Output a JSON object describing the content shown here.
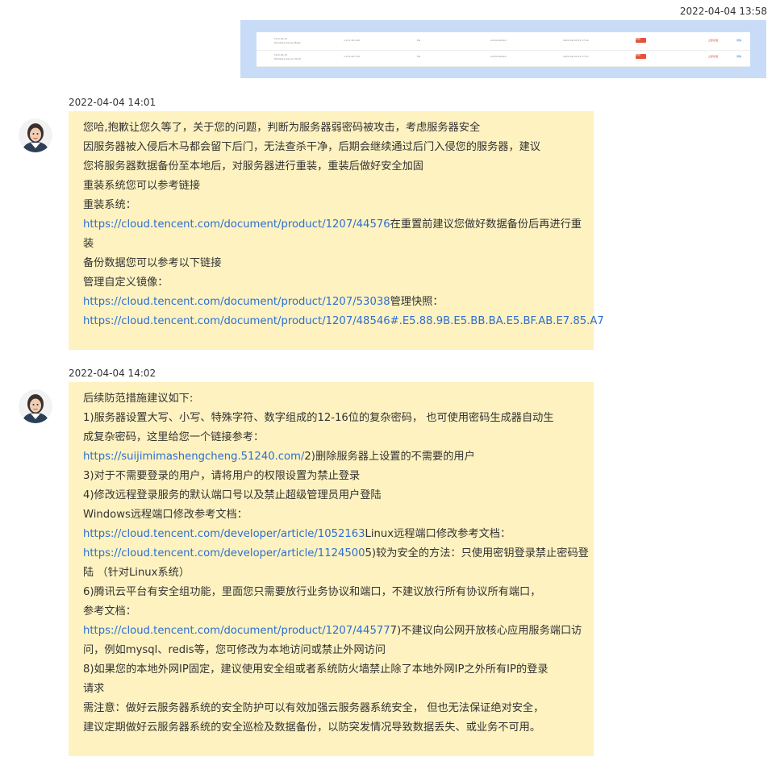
{
  "sent": {
    "timestamp": "2022-04-04 13:58",
    "screenshot_rows": [
      {
        "name": "10.0.16.15",
        "sub": "Windows Server Basic",
        "ip": "1.117.20.144",
        "type": "Pw",
        "user": "administrator",
        "time": "2022-04-03 22:17:42",
        "badge": "危险",
        "op": "立即处理",
        "link": "详情"
      },
      {
        "name": "10.0.16.15",
        "sub": "Windows Server 2019",
        "ip": "1.115.20.176",
        "type": "Pw",
        "user": "administrator",
        "time": "2022-04-03 22:17:47",
        "badge": "危险",
        "op": "立即处理",
        "link": "详情"
      }
    ]
  },
  "messages": [
    {
      "timestamp": "2022-04-04 14:01",
      "lines": [
        [
          {
            "t": "您哈,抱歉让您久等了，关于您的问题，判断为服务器弱密码被攻击，考虑服务器安全"
          }
        ],
        [
          {
            "t": "因服务器被入侵后木马都会留下后门，无法查杀干净，后期会继续通过后门入侵您的服务器，建议"
          }
        ],
        [
          {
            "t": "您将服务器数据备份至本地后，对服务器进行重装，重装后做好安全加固"
          }
        ],
        [
          {
            "t": "重装系统您可以参考链接"
          }
        ],
        [
          {
            "t": "重装系统："
          }
        ],
        [
          {
            "t": "https://cloud.tencent.com/document/product/1207/44576",
            "link": true
          },
          {
            "t": "在重置前建议您做好数据备份后再进行重"
          }
        ],
        [
          {
            "t": "装"
          }
        ],
        [
          {
            "t": "备份数据您可以参考以下链接"
          }
        ],
        [
          {
            "t": "管理自定义镜像："
          }
        ],
        [
          {
            "t": "https://cloud.tencent.com/document/product/1207/53038",
            "link": true
          },
          {
            "t": "管理快照："
          }
        ],
        [
          {
            "t": "https://cloud.tencent.com/document/product/1207/48546#.E5.88.9B.E5.BB.BA.E5.BF.AB.E7.85.A7",
            "link": true
          }
        ]
      ]
    },
    {
      "timestamp": "2022-04-04 14:02",
      "lines": [
        [
          {
            "t": "后续防范措施建议如下:"
          }
        ],
        [
          {
            "t": "1)服务器设置大写、小写、特殊字符、数字组成的12-16位的复杂密码， 也可使用密码生成器自动生"
          }
        ],
        [
          {
            "t": "成复杂密码，这里给您一个链接参考："
          }
        ],
        [
          {
            "t": "https://suijimimashengcheng.51240.com/",
            "link": true
          },
          {
            "t": "2)删除服务器上设置的不需要的用户"
          }
        ],
        [
          {
            "t": "3)对于不需要登录的用户，请将用户的权限设置为禁止登录"
          }
        ],
        [
          {
            "t": "4)修改远程登录服务的默认端口号以及禁止超级管理员用户登陆"
          }
        ],
        [
          {
            "t": "Windows远程端口修改参考文档："
          }
        ],
        [
          {
            "t": "https://cloud.tencent.com/developer/article/1052163",
            "link": true
          },
          {
            "t": "Linux远程端口修改参考文档："
          }
        ],
        [
          {
            "t": "https://cloud.tencent.com/developer/article/1124500",
            "link": true
          },
          {
            "t": "5)较为安全的方法：只使用密钥登录禁止密码登"
          }
        ],
        [
          {
            "t": "陆 （针对Linux系统）"
          }
        ],
        [
          {
            "t": "6)腾讯云平台有安全组功能，里面您只需要放行业务协议和端口，不建议放行所有协议所有端口，"
          }
        ],
        [
          {
            "t": "参考文档："
          }
        ],
        [
          {
            "t": "https://cloud.tencent.com/document/product/1207/44577",
            "link": true
          },
          {
            "t": "7)不建议向公网开放核心应用服务端口访"
          }
        ],
        [
          {
            "t": "问，例如mysql、redis等，您可修改为本地访问或禁止外网访问"
          }
        ],
        [
          {
            "t": "8)如果您的本地外网IP固定，建议使用安全组或者系统防火墙禁止除了本地外网IP之外所有IP的登录"
          }
        ],
        [
          {
            "t": "请求"
          }
        ],
        [
          {
            "t": "需注意：做好云服务器系统的安全防护可以有效加强云服务器系统安全， 但也无法保证绝对安全，"
          }
        ],
        [
          {
            "t": "建议定期做好云服务器系统的安全巡检及数据备份，以防突发情况导致数据丢失、或业务不可用。"
          }
        ]
      ]
    }
  ],
  "colors": {
    "bubble_bg": "#fef2c1",
    "link": "#2c6fd1",
    "sent_image_bg": "#c8dcf7",
    "badge": "#e8503a"
  },
  "icons": {
    "avatar": "agent-avatar"
  }
}
